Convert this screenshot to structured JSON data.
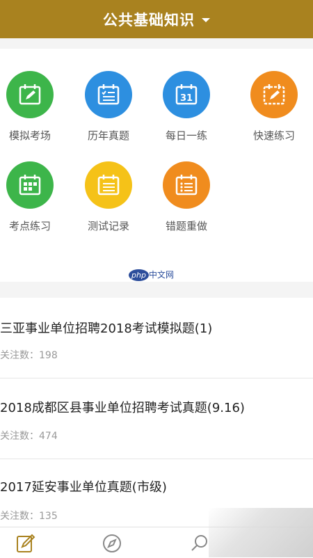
{
  "header": {
    "title": "公共基础知识"
  },
  "grid": {
    "items": [
      {
        "label": "模拟考场",
        "icon": "edit-calendar-icon",
        "color": "#3db54a"
      },
      {
        "label": "历年真题",
        "icon": "checklist-calendar-icon",
        "color": "#2d8fe0"
      },
      {
        "label": "每日一练",
        "icon": "calendar-31-icon",
        "color": "#2d8fe0"
      },
      {
        "label": "快速练习",
        "icon": "pencil-calendar-icon",
        "color": "#f08c1e"
      },
      {
        "label": "考点练习",
        "icon": "grid-calendar-icon",
        "color": "#3db54a"
      },
      {
        "label": "测试记录",
        "icon": "list-calendar-icon",
        "color": "#f5c218"
      },
      {
        "label": "错题重做",
        "icon": "bulleted-calendar-icon",
        "color": "#f08c1e"
      }
    ]
  },
  "watermark": {
    "php": "php",
    "text": "中文网"
  },
  "list": {
    "items": [
      {
        "title": "三亚事业单位招聘2018考试模拟题(1)",
        "meta": "关注数：198"
      },
      {
        "title": "2018成都区县事业单位招聘考试真题(9.16)",
        "meta": "关注数：474"
      },
      {
        "title": "2017延安事业单位真题(市级)",
        "meta": "关注数：135"
      }
    ]
  },
  "tabbar": {
    "items": [
      {
        "icon": "edit-icon",
        "color": "#a9821f"
      },
      {
        "icon": "compass-icon",
        "color": "#888888"
      },
      {
        "icon": "search-icon",
        "color": "#888888"
      }
    ]
  }
}
